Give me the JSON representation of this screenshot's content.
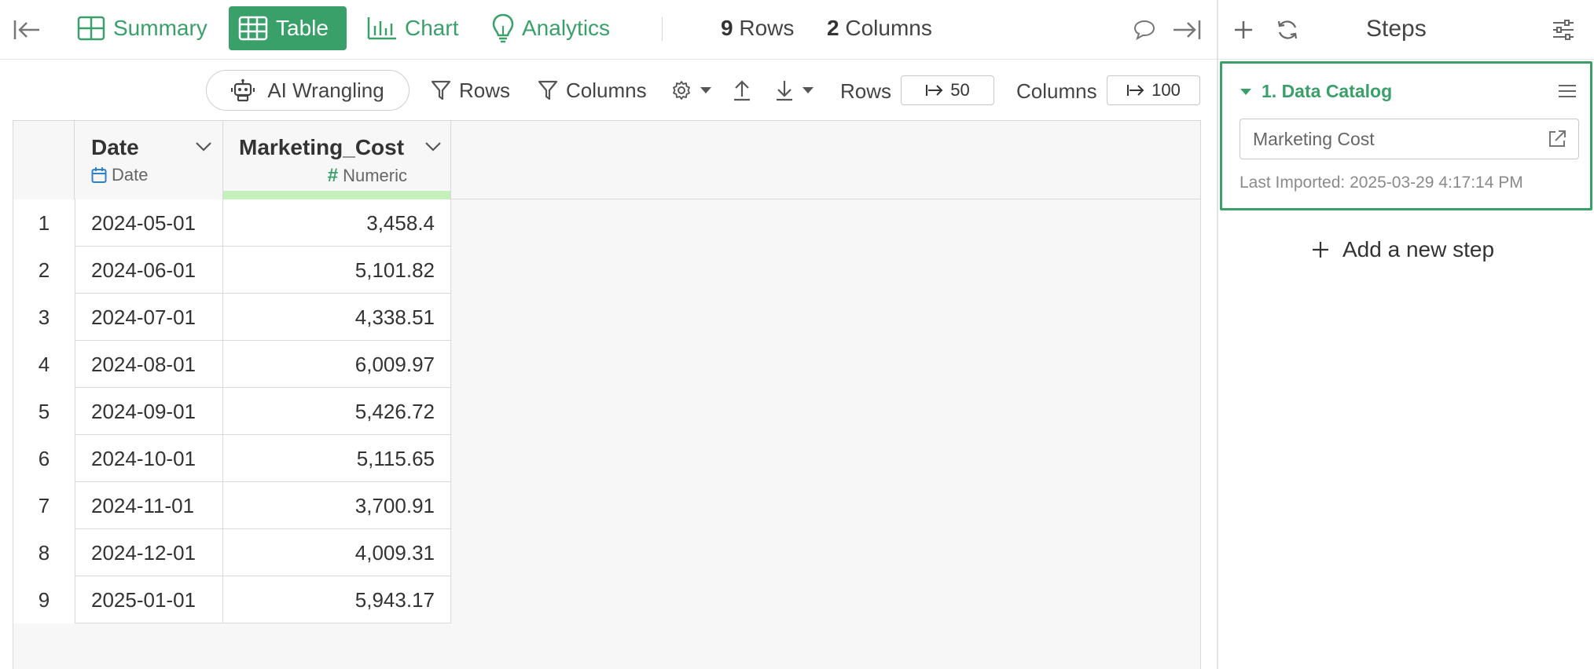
{
  "topbar": {
    "tabs": [
      {
        "label": "Summary",
        "icon": "summary-grid-icon",
        "active": false
      },
      {
        "label": "Table",
        "icon": "table-icon",
        "active": true
      },
      {
        "label": "Chart",
        "icon": "bar-chart-icon",
        "active": false
      },
      {
        "label": "Analytics",
        "icon": "lightbulb-icon",
        "active": false
      }
    ],
    "rows_count": "9",
    "rows_label": "Rows",
    "cols_count": "2",
    "cols_label": "Columns"
  },
  "toolbar": {
    "ai_label": "AI Wrangling",
    "rows_filter_label": "Rows",
    "cols_filter_label": "Columns",
    "rows_limit_label": "Rows",
    "rows_limit_value": "50",
    "cols_limit_label": "Columns",
    "cols_limit_value": "100"
  },
  "table": {
    "columns": [
      {
        "name": "Date",
        "type": "Date"
      },
      {
        "name": "Marketing_Cost",
        "type": "Numeric"
      }
    ],
    "rows": [
      {
        "n": "1",
        "date": "2024-05-01",
        "cost": "3,458.4"
      },
      {
        "n": "2",
        "date": "2024-06-01",
        "cost": "5,101.82"
      },
      {
        "n": "3",
        "date": "2024-07-01",
        "cost": "4,338.51"
      },
      {
        "n": "4",
        "date": "2024-08-01",
        "cost": "6,009.97"
      },
      {
        "n": "5",
        "date": "2024-09-01",
        "cost": "5,426.72"
      },
      {
        "n": "6",
        "date": "2024-10-01",
        "cost": "5,115.65"
      },
      {
        "n": "7",
        "date": "2024-11-01",
        "cost": "3,700.91"
      },
      {
        "n": "8",
        "date": "2024-12-01",
        "cost": "4,009.31"
      },
      {
        "n": "9",
        "date": "2025-01-01",
        "cost": "5,943.17"
      }
    ]
  },
  "steps_panel": {
    "title": "Steps",
    "step": {
      "title": "1. Data Catalog",
      "source": "Marketing Cost",
      "last_imported": "Last Imported: 2025-03-29 4:17:14 PM"
    },
    "add_step_label": "Add a new step"
  },
  "colors": {
    "accent": "#3aa06a",
    "numeric_bar": "#c5efbb",
    "date_icon": "#2f80d1"
  }
}
